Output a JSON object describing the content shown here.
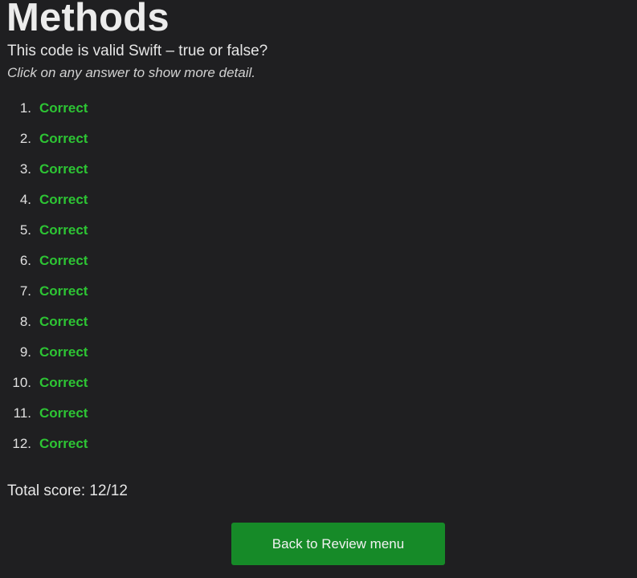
{
  "page": {
    "title": "Methods",
    "question": "This code is valid Swift – true or false?",
    "hint": "Click on any answer to show more detail."
  },
  "answers": [
    {
      "number": "1.",
      "verdict": "Correct"
    },
    {
      "number": "2.",
      "verdict": "Correct"
    },
    {
      "number": "3.",
      "verdict": "Correct"
    },
    {
      "number": "4.",
      "verdict": "Correct"
    },
    {
      "number": "5.",
      "verdict": "Correct"
    },
    {
      "number": "6.",
      "verdict": "Correct"
    },
    {
      "number": "7.",
      "verdict": "Correct"
    },
    {
      "number": "8.",
      "verdict": "Correct"
    },
    {
      "number": "9.",
      "verdict": "Correct"
    },
    {
      "number": "10.",
      "verdict": "Correct"
    },
    {
      "number": "11.",
      "verdict": "Correct"
    },
    {
      "number": "12.",
      "verdict": "Correct"
    }
  ],
  "score": {
    "text": "Total score: 12/12"
  },
  "actions": {
    "back_label": "Back to Review menu"
  },
  "colors": {
    "background": "#1f1f21",
    "correct": "#2dc434",
    "button": "#168a28"
  }
}
